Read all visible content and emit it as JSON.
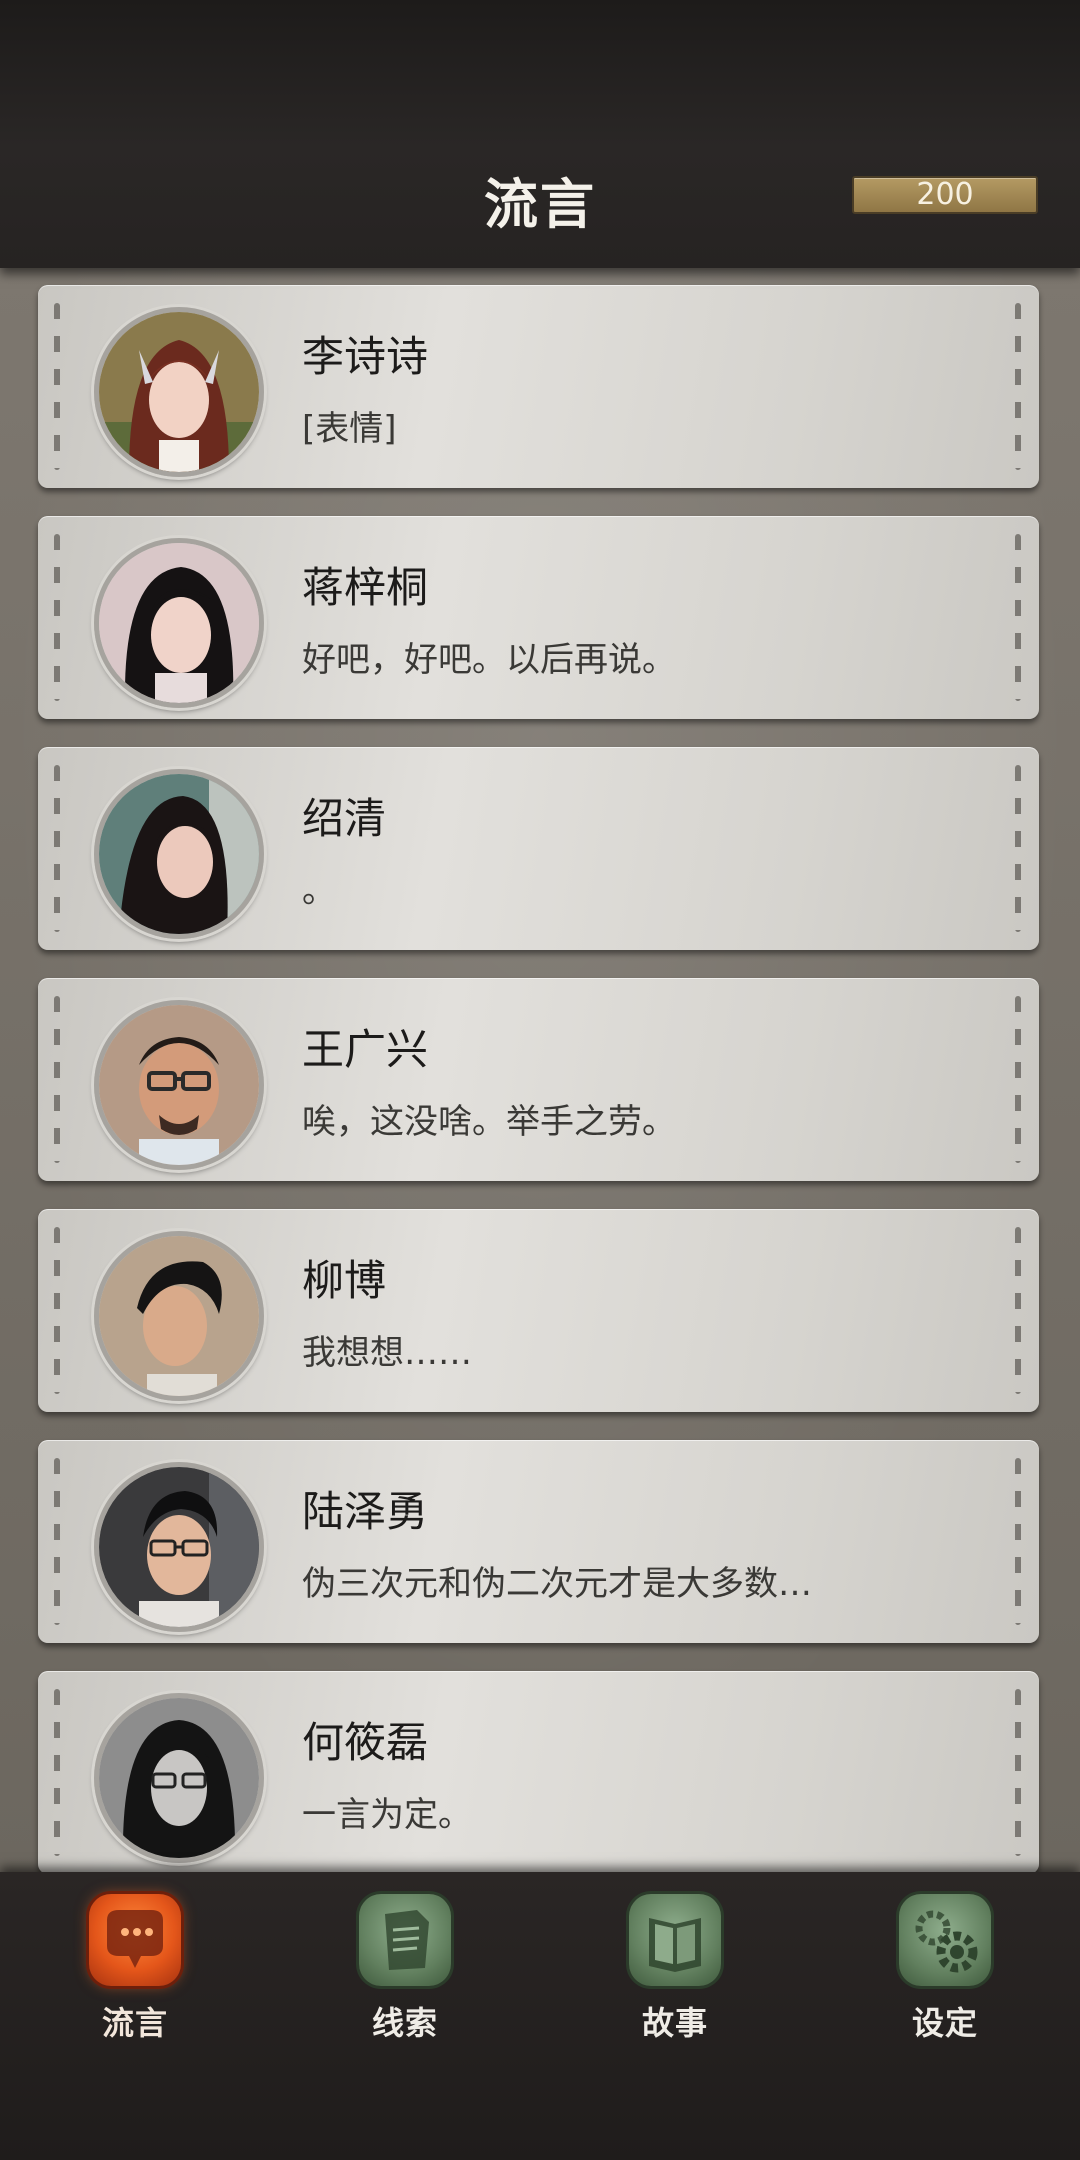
{
  "header": {
    "title": "流言",
    "currency_value": "200"
  },
  "contacts": [
    {
      "name": "李诗诗",
      "message": "[表情]",
      "avatar_icon": "woman-silver-hairclip-avatar"
    },
    {
      "name": "蒋梓桐",
      "message": "好吧，好吧。以后再说。",
      "avatar_icon": "woman-dark-hair-avatar"
    },
    {
      "name": "绍清",
      "message": "。",
      "avatar_icon": "woman-long-black-hair-avatar"
    },
    {
      "name": "王广兴",
      "message": "唉，这没啥。举手之劳。",
      "avatar_icon": "man-glasses-beard-avatar"
    },
    {
      "name": "柳博",
      "message": "我想想……",
      "avatar_icon": "man-slick-hair-avatar"
    },
    {
      "name": "陆泽勇",
      "message": "伪三次元和伪二次元才是大多数…",
      "avatar_icon": "man-glasses-smiling-avatar"
    },
    {
      "name": "何筱磊",
      "message": "一言为定。",
      "avatar_icon": "man-long-hair-glasses-avatar"
    }
  ],
  "bottom_nav": [
    {
      "label": "流言",
      "icon": "chat-bubble-icon",
      "active": true
    },
    {
      "label": "线索",
      "icon": "clue-paper-icon",
      "active": false
    },
    {
      "label": "故事",
      "icon": "story-book-icon",
      "active": false
    },
    {
      "label": "设定",
      "icon": "settings-gear-icon",
      "active": false
    }
  ],
  "colors": {
    "active_tab": "#e4561a",
    "idle_tab": "#62805f",
    "card_bg": "#dcdad5",
    "top_bar": "#262322"
  }
}
